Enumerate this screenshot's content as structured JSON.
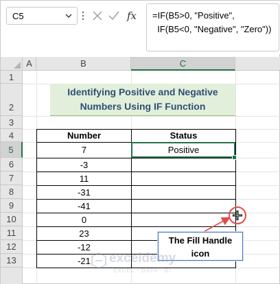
{
  "formula_bar": {
    "name_box": "C5",
    "cancel_icon": "close-icon",
    "enter_icon": "check-icon",
    "fx_label": "fx",
    "formula_line1": "=IF(B5>0, \"Positive\",",
    "formula_line2": "  IF(B5<0, \"Negative\", \"Zero\"))"
  },
  "columns": [
    "A",
    "B",
    "C"
  ],
  "rows": [
    "1",
    "2",
    "3",
    "4",
    "5",
    "6",
    "7",
    "8",
    "9",
    "10",
    "11",
    "12",
    "13"
  ],
  "title": {
    "line1": "Identifying Positive and Negative",
    "line2": "Numbers Using IF Function"
  },
  "table": {
    "headers": [
      "Number",
      "Status"
    ],
    "numbers": [
      "7",
      "-3",
      "11",
      "-31",
      "-41",
      "0",
      "23",
      "-12",
      "-21"
    ],
    "status": [
      "Positive",
      "",
      "",
      "",
      "",
      "",
      "",
      "",
      ""
    ]
  },
  "callout": {
    "line1": "The Fill Handle",
    "line2": "icon"
  },
  "watermark": {
    "name": "exceldemy",
    "sub": "EXCEL · DATA · BI"
  },
  "colors": {
    "selection_green": "#217346",
    "title_fill": "#e2efda",
    "title_text": "#2f4f75",
    "callout_border": "#4472c4",
    "highlight_red": "#e34a4a"
  }
}
